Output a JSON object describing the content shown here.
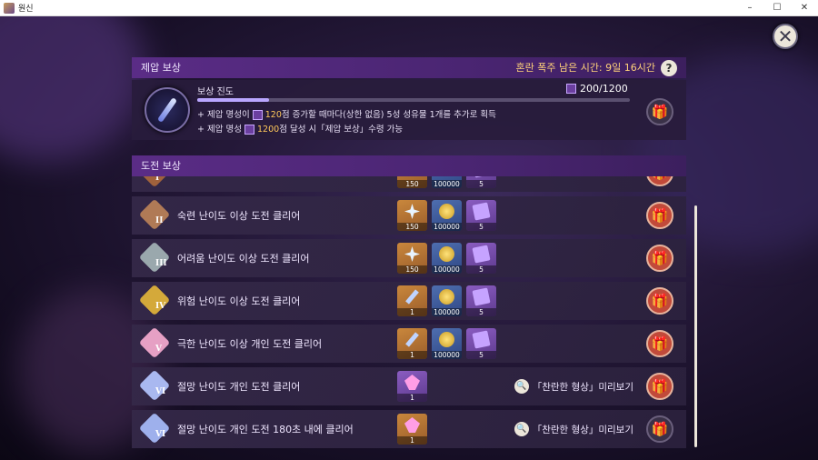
{
  "window": {
    "title": "원신",
    "controls": [
      "–",
      "☐",
      "✕"
    ]
  },
  "game": {
    "close_icon": "✕",
    "suppression": {
      "heading": "제압 보상",
      "remaining_text": "혼란 폭주 남은 시간: 9일 16시간",
      "help_icon": "?",
      "progress_label": "보상 진도",
      "progress_count": "200/1200",
      "progress_fraction": 0.167,
      "line1_pre": "+ 제압 명성이 ",
      "line1_hl": "120",
      "line1_post": "점 증가할 때마다(상한 없음) 5성 성유물 1개를 추가로 획득",
      "line2_pre": "+ 제압 명성 ",
      "line2_hl": "1200",
      "line2_post": "점 달성 시「제압 보상」수령 가능",
      "gift_icon": "🎁"
    },
    "challenge": {
      "heading": "도전 보상",
      "rows": [
        {
          "numeral": "I",
          "text": "",
          "items": [
            {
              "k": "gold",
              "a": "star",
              "c": "150"
            },
            {
              "k": "blue",
              "a": "coin",
              "c": "100000"
            },
            {
              "k": "purple",
              "a": "book",
              "c": "5"
            }
          ],
          "gift": "red",
          "badge": "#a0623c",
          "preview": ""
        },
        {
          "numeral": "II",
          "text": "숙련 난이도 이상 도전 클리어",
          "items": [
            {
              "k": "gold",
              "a": "star",
              "c": "150"
            },
            {
              "k": "blue",
              "a": "coin",
              "c": "100000"
            },
            {
              "k": "purple",
              "a": "book",
              "c": "5"
            }
          ],
          "gift": "red",
          "badge": "#b07a56",
          "preview": ""
        },
        {
          "numeral": "III",
          "text": "어려움 난이도 이상 도전 클리어",
          "items": [
            {
              "k": "gold",
              "a": "star",
              "c": "150"
            },
            {
              "k": "blue",
              "a": "coin",
              "c": "100000"
            },
            {
              "k": "purple",
              "a": "book",
              "c": "5"
            }
          ],
          "gift": "red",
          "badge": "#9aa8ad",
          "preview": ""
        },
        {
          "numeral": "IV",
          "text": "위험 난이도 이상 도전 클리어",
          "items": [
            {
              "k": "gold",
              "a": "wand",
              "c": "1"
            },
            {
              "k": "blue",
              "a": "coin",
              "c": "100000"
            },
            {
              "k": "purple",
              "a": "book",
              "c": "5"
            }
          ],
          "gift": "red",
          "badge": "#d4a93a",
          "preview": ""
        },
        {
          "numeral": "V",
          "text": "극한 난이도 이상 개인 도전 클리어",
          "items": [
            {
              "k": "gold",
              "a": "wand",
              "c": "1"
            },
            {
              "k": "blue",
              "a": "coin",
              "c": "100000"
            },
            {
              "k": "purple",
              "a": "book",
              "c": "5"
            }
          ],
          "gift": "red",
          "badge": "#e6a0c4",
          "preview": ""
        },
        {
          "numeral": "VI",
          "text": "절망 난이도 개인 도전 클리어",
          "items": [
            {
              "k": "purple",
              "a": "crystal",
              "c": "1"
            }
          ],
          "gift": "red",
          "badge": "#a9b8f0",
          "preview": "「찬란한 형상」미리보기"
        },
        {
          "numeral": "VI",
          "text": "절망 난이도 개인 도전 180초 내에 클리어",
          "items": [
            {
              "k": "gold",
              "a": "crystal",
              "c": "1"
            }
          ],
          "gift": "grey",
          "badge": "#9eb0ec",
          "preview": "「찬란한 형상」미리보기"
        }
      ]
    },
    "preview_icon": "🔍",
    "colors": {
      "accent": "#5a2c86",
      "highlight": "#ffc85a",
      "gift_red": "#c14a3a"
    }
  }
}
